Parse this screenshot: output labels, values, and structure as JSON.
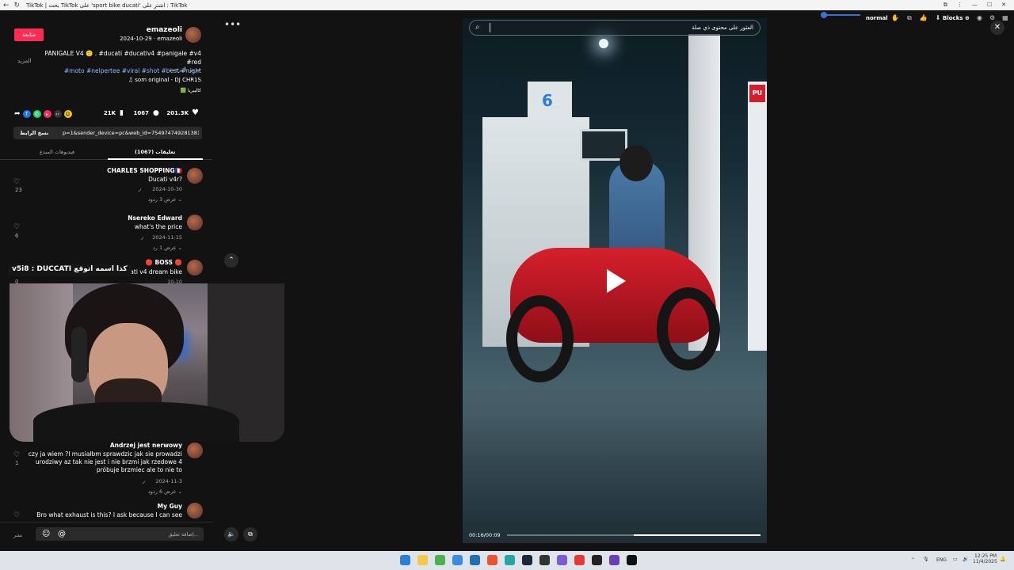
{
  "browser": {
    "tab_title": "TikTok | بحث TikTok على 'sport bike ducati' اشترِ على : TikTok",
    "nav_icons": [
      "back-icon",
      "reload-icon"
    ]
  },
  "topbar": {
    "volume_label": "normal",
    "blocks_label": "Blocks ⊕",
    "close_glyph": "✕"
  },
  "post": {
    "follow_label": "متابعة",
    "author": "emazeoli",
    "meta": "2024-10-29 · emazeoli",
    "caption_line1": "PANIGALE V4 🙂 . #ducati #ducativ4 #panigale #v4 #red",
    "caption_line2": "#moto #nelpertee #viral #shot #best #night",
    "more_label": "المزيد",
    "translate_label": "عرض الترجمة",
    "sound": "♫ som original - DJ CHR1S",
    "tag": "🟩 كاليبريا",
    "likes": "201.3K",
    "comments_count": "1067",
    "saves": "21K",
    "link_text": "p=1&sender_device=pc&web_id=7549747492813817362...",
    "copy_link_label": "نسخ الرابط",
    "tab_comments": "تعليقات (1067)",
    "tab_creator": "فيديوهات المبدع"
  },
  "comments": [
    {
      "user": "CHARLES SHOPPING🇫🇷",
      "text": "Ducati v4r?",
      "date": "2024-10-30",
      "reply": "ر",
      "likes": "23",
      "replies": "عرض 3 ردود ⌄"
    },
    {
      "user": "Nsereko Edward",
      "text": "what's the price",
      "date": "2024-11-15",
      "reply": "ر",
      "likes": "6",
      "replies": "عرض 1 رد ⌄"
    },
    {
      "user": "🔴 BOSS 🔴",
      "text": "so 🇲🇨 lover ducati v4 dream bike",
      "date": "10-10",
      "reply": "",
      "likes": "0",
      "replies": ""
    },
    {
      "user": "Andrzej jest nerwowy",
      "text1": "czy ja wiem ?I musiałbm sprawdzic jak sie prowadzi",
      "text2": "urodziwy az tak nie jest i nie brzmi jak rzedowe 4",
      "text3": "próbuje brzmiec ale to nie to",
      "date": "2024-11-3",
      "reply": "ر",
      "likes": "1",
      "replies": "عرض 6 ردود ⌄"
    },
    {
      "user": "My Guy",
      "text": "Bro what exhaust is this? I ask because I can see",
      "likes": ""
    }
  ],
  "overlay": {
    "stream_text": "v5i8 : DUCCATI كذا اسمه اتوقع"
  },
  "composer": {
    "placeholder": "إضافة تعليق...",
    "post_label": "نشر",
    "emoji_icon": "☺",
    "mention_icon": "@"
  },
  "video": {
    "search_placeholder": "العثور على محتوى ذي صلة",
    "time": "00:16/00:09",
    "progress": 0.5,
    "pump_number": "6"
  },
  "taskbar": {
    "lang": "ENG",
    "time": "12:25 PM",
    "date": "11/4/2025"
  },
  "colors": {
    "accent": "#fe2c55",
    "link": "#8fb6ff",
    "bg": "#121212"
  }
}
